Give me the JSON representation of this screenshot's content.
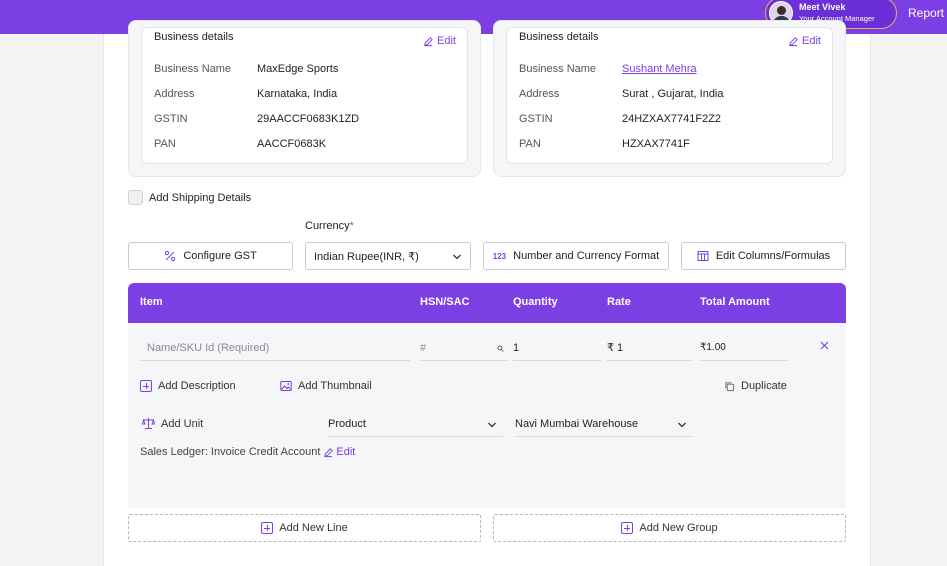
{
  "header": {
    "manager_name": "Meet Vivek",
    "manager_role": "Your Account Manager",
    "report_label": "Report a"
  },
  "business_from": {
    "title": "Business details",
    "edit_label": "Edit",
    "rows": [
      {
        "label": "Business Name",
        "value": "MaxEdge Sports"
      },
      {
        "label": "Address",
        "value": "Karnataka, India"
      },
      {
        "label": "GSTIN",
        "value": "29AACCF0683K1ZD"
      },
      {
        "label": "PAN",
        "value": "AACCF0683K"
      }
    ]
  },
  "business_to": {
    "title": "Business details",
    "edit_label": "Edit",
    "rows": [
      {
        "label": "Business Name",
        "value": "Sushant Mehra"
      },
      {
        "label": "Address",
        "value": "Surat , Gujarat, India"
      },
      {
        "label": "GSTIN",
        "value": "24HZXAX7741F2Z2"
      },
      {
        "label": "PAN",
        "value": "HZXAX7741F"
      }
    ]
  },
  "shipping": {
    "label": "Add Shipping Details",
    "checked": false
  },
  "currency": {
    "label": "Currency",
    "required_mark": "*",
    "selected": "Indian Rupee(INR, ₹)"
  },
  "toolbar": {
    "configure_gst": "Configure GST",
    "number_format": "Number and Currency Format",
    "number_format_badge": "123",
    "edit_columns": "Edit Columns/Formulas"
  },
  "table": {
    "headers": [
      "Item",
      "HSN/SAC",
      "Quantity",
      "Rate",
      "Total Amount"
    ],
    "row": {
      "name_placeholder": "Name/SKU Id (Required)",
      "hsn_placeholder": "#",
      "quantity": "1",
      "rate": "₹ 1",
      "total": "₹1.00",
      "add_description": "Add Description",
      "add_thumbnail": "Add Thumbnail",
      "duplicate": "Duplicate",
      "add_unit": "Add Unit",
      "unit_type": "Product",
      "warehouse": "Navi Mumbai Warehouse",
      "ledger_text": "Sales Ledger: Invoice Credit Account",
      "ledger_edit": "Edit"
    }
  },
  "footer": {
    "add_line": "Add New Line",
    "add_group": "Add New Group"
  },
  "colors": {
    "brand": "#7b3fe4",
    "required": "#e0455a",
    "manager_ring": "#e8a95c"
  }
}
